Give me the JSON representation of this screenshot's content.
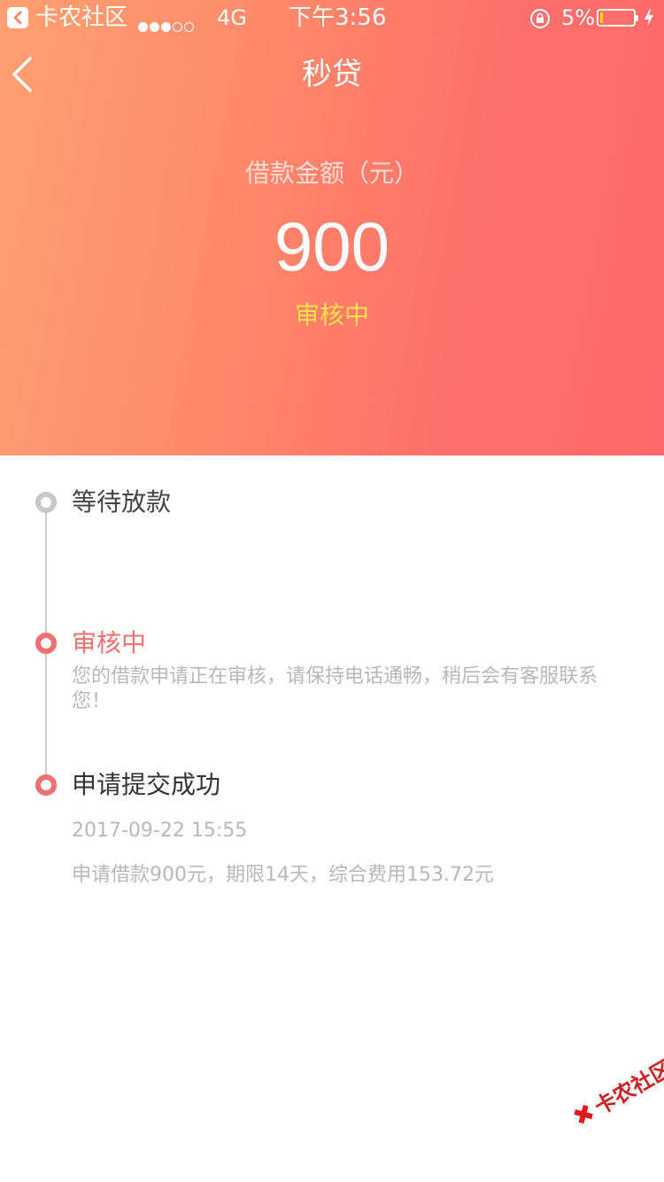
{
  "colors": {
    "header_start": "#ffa070",
    "header_end": "#ff6868",
    "status_yellow": "#ffe14d",
    "step_active": "#f07070",
    "step_done": "#333333",
    "step_pending": "#444444",
    "desc_grey": "#b8b8b8"
  },
  "status_bar": {
    "back_app": "卡农社区",
    "signal_dots_filled": 3,
    "signal_dots_total": 5,
    "network": "4G",
    "time": "下午3:56",
    "battery_percent_text": "5%",
    "battery_level": 0.05,
    "icons": [
      "back-app-icon",
      "orientation-lock-icon",
      "battery-icon",
      "charging-icon"
    ]
  },
  "nav": {
    "title": "秒贷",
    "back_icon": "chevron-left-icon"
  },
  "amount": {
    "label": "借款金额（元）",
    "value": "900",
    "status": "审核中"
  },
  "timeline": {
    "steps": [
      {
        "title": "等待放款",
        "state": "pending"
      },
      {
        "title": "审核中",
        "state": "active",
        "description": "您的借款申请正在审核，请保持电话通畅，稍后会有客服联系您！"
      },
      {
        "title": "申请提交成功",
        "state": "done",
        "time": "2017-09-22 15:55",
        "detail": "申请借款900元，期限14天，综合费用153.72元"
      }
    ]
  },
  "watermark": {
    "text": "卡农社区"
  }
}
